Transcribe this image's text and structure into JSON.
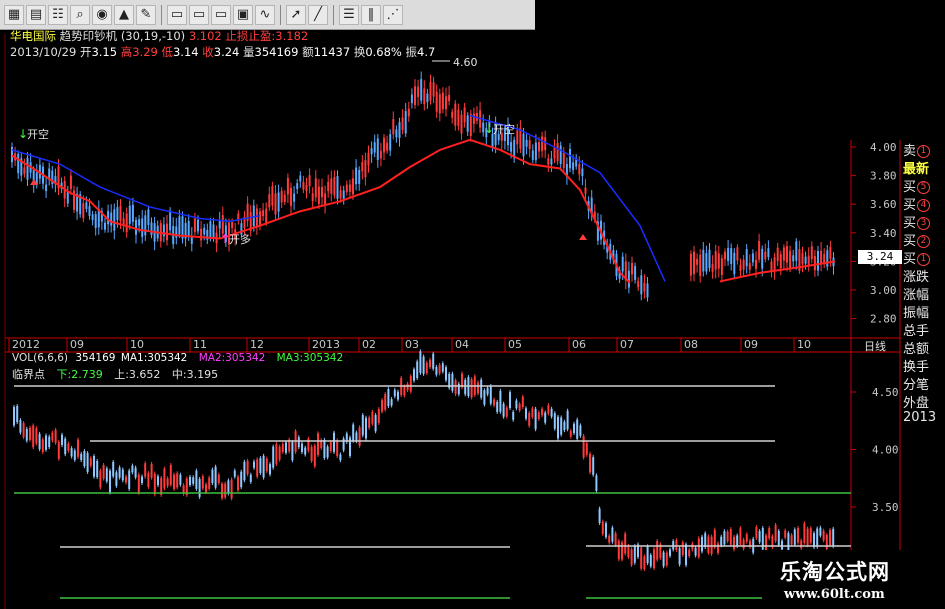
{
  "toolbar": {
    "icons": [
      "grid-icon",
      "table-icon",
      "contacts-icon",
      "search-tool-icon",
      "stock-icon",
      "alert-icon",
      "pencil-icon",
      "window-icon",
      "window2-icon",
      "window3-icon",
      "chart-window-icon",
      "line-chart-icon",
      "cursor-icon",
      "line-draw-icon",
      "menu-icon",
      "bars-icon",
      "fan-icon"
    ]
  },
  "header": {
    "stock_name": "华电国际",
    "indicator": "趋势印钞机",
    "params": "(30,19,-10)",
    "indicator_value": "3.102",
    "stop_label": "止损止盈:3.182",
    "date": "2013/10/29",
    "open_label": "开",
    "open": "3.15",
    "high_label": "高",
    "high": "3.29",
    "low_label": "低",
    "low": "3.14",
    "close_label": "收",
    "close": "3.24",
    "volume_label": "量",
    "volume": "354169",
    "amount_label": "额",
    "amount": "11437",
    "turnover_label": "换",
    "turnover": "0.68%",
    "amplitude_label": "振",
    "amplitude": "4.7"
  },
  "upper_chart": {
    "y_ticks": [
      "4.00",
      "3.80",
      "3.60",
      "3.40",
      "3.20",
      "3.00",
      "2.80"
    ],
    "peak_label": "4.60",
    "signals": [
      "开空",
      "开多",
      "开空"
    ],
    "x_ticks": [
      "2012",
      "09",
      "10",
      "11",
      "12",
      "2013",
      "02",
      "03",
      "04",
      "05",
      "06",
      "07",
      "08",
      "09",
      "10"
    ],
    "period_label": "日线"
  },
  "lower_chart": {
    "vol_label": "VOL(6,6,6)",
    "vol_value": "354169",
    "ma1_label": "MA1:305342",
    "ma2_label": "MA2:305342",
    "ma3_label": "MA3:305342",
    "critical_label": "临界点",
    "down_label": "下:2.739",
    "up_label": "上:3.652",
    "mid_label": "中:3.195",
    "y_ticks": [
      "4.50",
      "4.00",
      "3.50"
    ]
  },
  "right_panel": {
    "items": [
      "卖",
      "最新",
      "买",
      "买",
      "买",
      "买",
      "买",
      "涨跌",
      "涨幅",
      "振幅",
      "总手",
      "总额",
      "换手",
      "分笔",
      "外盘",
      "2013"
    ],
    "badges": [
      "1",
      "",
      "5",
      "4",
      "3",
      "2",
      "1",
      "",
      "",
      "",
      "",
      "",
      "",
      "",
      "",
      ""
    ],
    "price_tag": "3.24"
  },
  "watermark": {
    "title": "乐淘公式网",
    "url": "www.60lt.com"
  },
  "colors": {
    "up": "#ff3b3b",
    "down": "#5aa8ff",
    "ma_red": "#ff2020",
    "ma_blue": "#1a2cff",
    "grid": "#7a0000",
    "axis_text": "#c8c8c8",
    "yellow": "#ffff40",
    "magenta": "#ff40ff"
  }
}
